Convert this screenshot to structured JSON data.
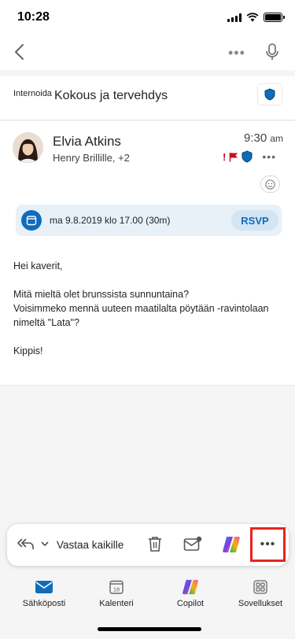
{
  "status_bar": {
    "time": "10:28"
  },
  "subject": {
    "tag": "Internoida",
    "title": "Kokous ja tervehdys"
  },
  "message": {
    "sender": "Elvia Atkins",
    "recipients": "Henry Brillille, +2",
    "time": "9:30",
    "time_suffix": "am",
    "importance": "!",
    "event": {
      "when": "ma 9.8.2019 klo 17.00 (30m)",
      "rsvp": "RSVP"
    },
    "body": {
      "greeting": "Hei kaverit,",
      "line1": "Mitä mieltä olet brunssista sunnuntaina?",
      "line2": "Voisimmeko mennä uuteen maatilalta pöytään -ravintolaan",
      "line3": "nimeltä \"Lata\"?",
      "signoff": "Kippis!"
    }
  },
  "action_bar": {
    "reply_all_label": "Vastaa kaikille"
  },
  "tabs": [
    {
      "label": "Sähköposti",
      "icon": "mail-icon"
    },
    {
      "label": "Kalenteri",
      "icon": "calendar-icon",
      "day": "18"
    },
    {
      "label": "Copilot",
      "icon": "copilot-icon"
    },
    {
      "label": "Sovellukset",
      "icon": "apps-icon"
    }
  ],
  "colors": {
    "accent": "#0f6cbd",
    "highlight": "#e8231c",
    "flag": "#c50f1f"
  }
}
